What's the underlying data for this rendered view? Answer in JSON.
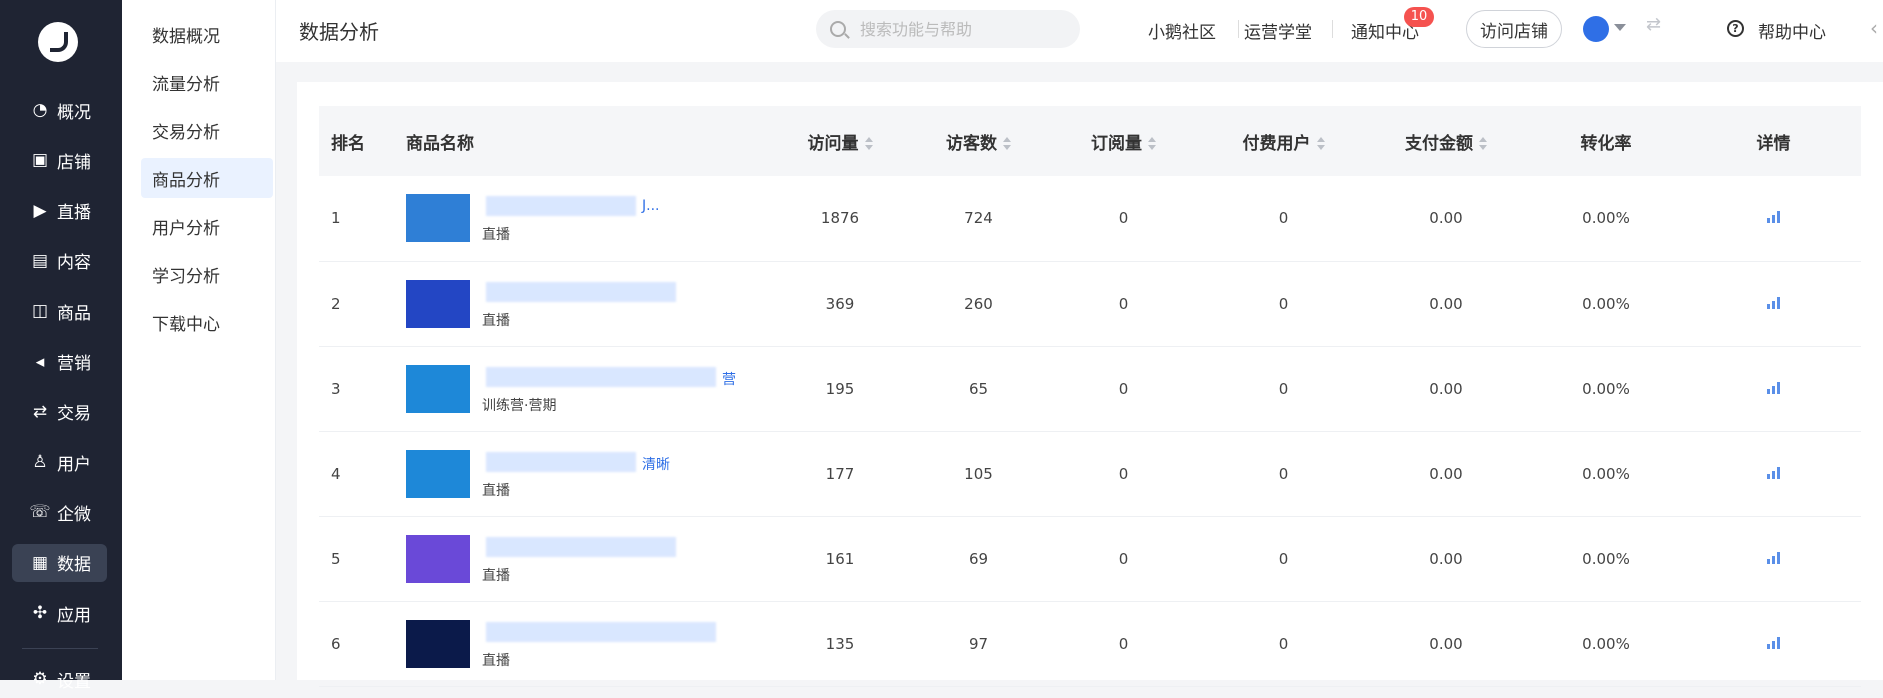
{
  "nav": {
    "items": [
      {
        "icon": "◔",
        "label": "概况",
        "name": "overview"
      },
      {
        "icon": "▣",
        "label": "店铺",
        "name": "shop"
      },
      {
        "icon": "▶",
        "label": "直播",
        "name": "live"
      },
      {
        "icon": "▤",
        "label": "内容",
        "name": "content"
      },
      {
        "icon": "◫",
        "label": "商品",
        "name": "goods"
      },
      {
        "icon": "◂",
        "label": "营销",
        "name": "marketing"
      },
      {
        "icon": "⇄",
        "label": "交易",
        "name": "trade"
      },
      {
        "icon": "♙",
        "label": "用户",
        "name": "users"
      },
      {
        "icon": "☏",
        "label": "企微",
        "name": "wecom"
      },
      {
        "icon": "▦",
        "label": "数据",
        "name": "data"
      },
      {
        "icon": "✣",
        "label": "应用",
        "name": "apps"
      }
    ],
    "bottom_label": "设置"
  },
  "subnav": {
    "items": [
      "数据概况",
      "流量分析",
      "交易分析",
      "商品分析",
      "用户分析",
      "学习分析",
      "下载中心"
    ]
  },
  "header": {
    "title": "数据分析",
    "search_placeholder": "搜索功能与帮助",
    "links": [
      "小鹅社区",
      "运营学堂",
      "通知中心"
    ],
    "notification_count": "10",
    "visit_button": "访问店铺",
    "help": "帮助中心"
  },
  "table": {
    "headers": [
      "排名",
      "商品名称",
      "访问量",
      "访客数",
      "订阅量",
      "付费用户",
      "支付金额",
      "转化率",
      "详情"
    ],
    "rows": [
      {
        "rank": "1",
        "name": "J...",
        "type": "直播",
        "visits": "1876",
        "visitors": "724",
        "subs": "0",
        "paid_users": "0",
        "amount": "0.00",
        "rate": "0.00%",
        "thumb_bg": "#2f7fd6"
      },
      {
        "rank": "2",
        "name": "",
        "type": "直播",
        "visits": "369",
        "visitors": "260",
        "subs": "0",
        "paid_users": "0",
        "amount": "0.00",
        "rate": "0.00%",
        "thumb_bg": "#2346c4"
      },
      {
        "rank": "3",
        "name": "营",
        "type": "训练营·营期",
        "visits": "195",
        "visitors": "65",
        "subs": "0",
        "paid_users": "0",
        "amount": "0.00",
        "rate": "0.00%",
        "thumb_bg": "#1e88d8"
      },
      {
        "rank": "4",
        "name": "清晰",
        "type": "直播",
        "visits": "177",
        "visitors": "105",
        "subs": "0",
        "paid_users": "0",
        "amount": "0.00",
        "rate": "0.00%",
        "thumb_bg": "#1e88d8"
      },
      {
        "rank": "5",
        "name": "",
        "type": "直播",
        "visits": "161",
        "visitors": "69",
        "subs": "0",
        "paid_users": "0",
        "amount": "0.00",
        "rate": "0.00%",
        "thumb_bg": "#6a49d8"
      },
      {
        "rank": "6",
        "name": "",
        "type": "直播",
        "visits": "135",
        "visitors": "97",
        "subs": "0",
        "paid_users": "0",
        "amount": "0.00",
        "rate": "0.00%",
        "thumb_bg": "#0b1a4a"
      }
    ]
  }
}
